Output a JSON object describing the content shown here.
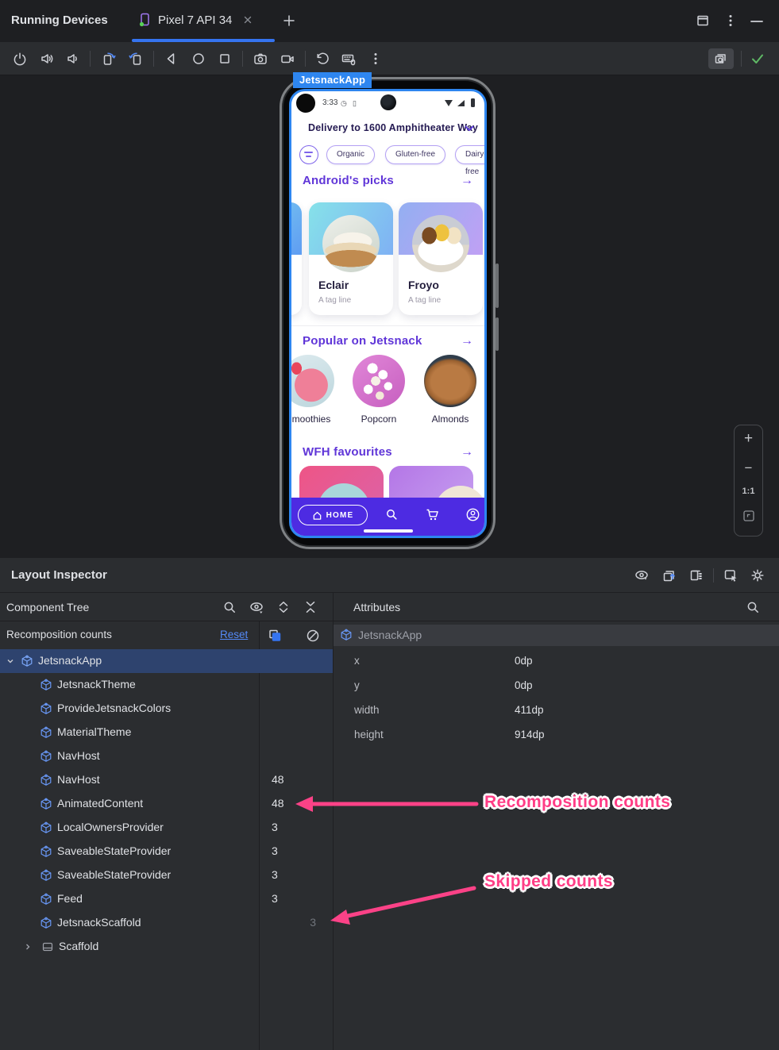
{
  "tabbar": {
    "window_title": "Running Devices",
    "tab_label": "Pixel 7 API 34"
  },
  "emulator": {
    "app_badge": "JetsnackApp",
    "status_time": "3:33",
    "delivery_label": "Delivery to 1600 Amphitheater Way",
    "chips": [
      {
        "label": "Organic"
      },
      {
        "label": "Gluten-free"
      },
      {
        "label": "Dairy-free"
      }
    ],
    "sections": {
      "picks": "Android's picks",
      "popular": "Popular on Jetsnack",
      "wfh": "WFH favourites"
    },
    "section_arrow": "→",
    "cards": [
      {
        "name": "Eclair",
        "tag": "A tag line"
      },
      {
        "name": "Froyo",
        "tag": "A tag line"
      }
    ],
    "popular_items": [
      {
        "label": "Smoothies"
      },
      {
        "label": "Popcorn"
      },
      {
        "label": "Almonds"
      }
    ],
    "nav": {
      "home": "HOME"
    }
  },
  "zoom_controls": {
    "zoom_in": "+",
    "zoom_out": "−",
    "ratio": "1:1"
  },
  "inspector": {
    "title": "Layout Inspector"
  },
  "component_tree": {
    "header": "Component Tree",
    "recomposition_label": "Recomposition counts",
    "reset_label": "Reset",
    "rows": [
      {
        "label": "JetsnackApp",
        "count": "",
        "skipped": ""
      },
      {
        "label": "JetsnackTheme",
        "count": "",
        "skipped": ""
      },
      {
        "label": "ProvideJetsnackColors",
        "count": "",
        "skipped": ""
      },
      {
        "label": "MaterialTheme",
        "count": "",
        "skipped": ""
      },
      {
        "label": "NavHost",
        "count": "",
        "skipped": ""
      },
      {
        "label": "NavHost",
        "count": "48",
        "skipped": ""
      },
      {
        "label": "AnimatedContent",
        "count": "48",
        "skipped": ""
      },
      {
        "label": "LocalOwnersProvider",
        "count": "3",
        "skipped": ""
      },
      {
        "label": "SaveableStateProvider",
        "count": "3",
        "skipped": ""
      },
      {
        "label": "SaveableStateProvider",
        "count": "3",
        "skipped": ""
      },
      {
        "label": "Feed",
        "count": "3",
        "skipped": ""
      },
      {
        "label": "JetsnackScaffold",
        "count": "",
        "skipped": "3"
      },
      {
        "label": "Scaffold",
        "count": "",
        "skipped": ""
      }
    ]
  },
  "attributes": {
    "header": "Attributes",
    "component": "JetsnackApp",
    "rows": [
      {
        "name": "x",
        "value": "0dp"
      },
      {
        "name": "y",
        "value": "0dp"
      },
      {
        "name": "width",
        "value": "411dp"
      },
      {
        "name": "height",
        "value": "914dp"
      }
    ]
  },
  "annotations": {
    "recomposition": "Recomposition counts",
    "skipped": "Skipped counts"
  },
  "colors": {
    "accent_blue": "#3574F0",
    "selection_blue": "#2E436E",
    "annotation_pink": "#FF3D86",
    "nav_indigo": "#4D2BE2",
    "jetsnack_purple": "#6036D8",
    "badge_blue": "#2E86F0",
    "check_green": "#5FB865"
  }
}
